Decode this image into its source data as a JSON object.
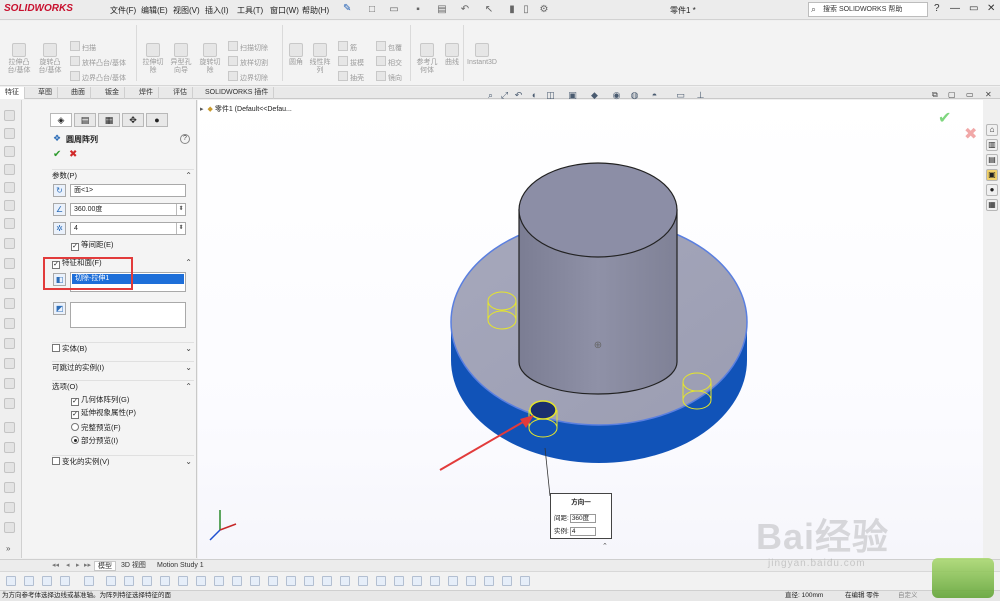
{
  "app": {
    "logo": "SOLIDWORKS",
    "doc_title": "零件1 *",
    "search_placeholder": "搜索 SOLIDWORKS 帮助"
  },
  "menu": [
    "文件(F)",
    "编辑(E)",
    "视图(V)",
    "插入(I)",
    "工具(T)",
    "窗口(W)",
    "帮助(H)"
  ],
  "toolbar": {
    "features_large": [
      {
        "label": "拉伸凸\n台/基体",
        "icon": "extrude-boss-icon"
      },
      {
        "label": "旋转凸\n台/基体",
        "icon": "revolve-boss-icon"
      },
      {
        "label": "拉伸切\n除",
        "icon": "extrude-cut-icon"
      },
      {
        "label": "异型孔\n向导",
        "icon": "hole-wizard-icon"
      },
      {
        "label": "旋转切\n除",
        "icon": "revolve-cut-icon"
      },
      {
        "label": "圆角",
        "icon": "fillet-icon"
      },
      {
        "label": "线性阵\n列",
        "icon": "linear-pattern-icon"
      },
      {
        "label": "参考几\n何体",
        "icon": "reference-geometry-icon"
      },
      {
        "label": "曲线",
        "icon": "curves-icon"
      },
      {
        "label": "Instant3D",
        "icon": "instant3d-icon"
      }
    ],
    "features_small": [
      {
        "label": "扫描",
        "icon": "sweep-icon"
      },
      {
        "label": "放样凸台/基体",
        "icon": "loft-icon"
      },
      {
        "label": "边界凸台/基体",
        "icon": "boundary-boss-icon"
      },
      {
        "label": "扫描切除",
        "icon": "swept-cut-icon"
      },
      {
        "label": "放样切割",
        "icon": "lofted-cut-icon"
      },
      {
        "label": "边界切除",
        "icon": "boundary-cut-icon"
      },
      {
        "label": "筋",
        "icon": "rib-icon"
      },
      {
        "label": "拔模",
        "icon": "draft-icon"
      },
      {
        "label": "抽壳",
        "icon": "shell-icon"
      },
      {
        "label": "包覆",
        "icon": "wrap-icon"
      },
      {
        "label": "相交",
        "icon": "intersect-icon"
      },
      {
        "label": "镜向",
        "icon": "mirror-icon"
      }
    ]
  },
  "tabs": [
    "特征",
    "草图",
    "曲面",
    "钣金",
    "焊件",
    "评估",
    "SOLIDWORKS 插件"
  ],
  "property_manager": {
    "title": "圆周阵列",
    "params_header": "参数(P)",
    "axis_value": "面<1>",
    "angle_value": "360.00度",
    "count_value": "4",
    "equal_spacing": "等间距(E)",
    "features_header": "特征和面(F)",
    "feature_item": "切除-拉伸1",
    "bodies_header": "实体(B)",
    "skip_header": "可跳过的实例(I)",
    "options_header": "选项(O)",
    "opt_geometry": "几何体阵列(G)",
    "opt_propagate": "延伸视象属性(P)",
    "opt_full_preview": "完整预览(F)",
    "opt_partial_preview": "部分预览(I)",
    "vary_header": "变化的实例(V)"
  },
  "feature_tree": {
    "item": "零件1  (Default<<Defau..."
  },
  "callout": {
    "title": "方向一",
    "spacing_label": "间距:",
    "spacing_value": "360度",
    "instances_label": "实例:",
    "instances_value": "4"
  },
  "bottom_tabs": [
    "模型",
    "3D 视图",
    "Motion Study 1"
  ],
  "status": {
    "hint": "为方向参考体选择边线或基准轴。为阵列特征选择特征的面",
    "diameter": "直径: 100mm",
    "editing": "在编辑 零件",
    "custom": "自定义"
  },
  "watermark": {
    "main": "Bai经验",
    "sub": "jingyan.baidu.com"
  },
  "colors": {
    "accent_blue": "#1e6fd9",
    "model_gray": "#8c8ea6",
    "model_blue": "#1153b8",
    "highlight_red": "#e23b3b"
  }
}
